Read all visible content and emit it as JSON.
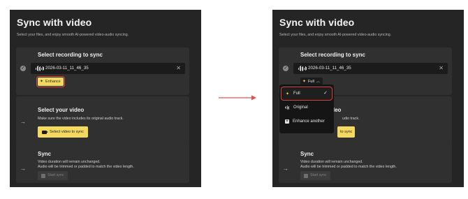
{
  "left": {
    "title": "Sync with video",
    "subtitle": "Select your files, and enjoy smooth AI-powered video-audio syncing.",
    "recording": {
      "title": "Select recording to sync",
      "file_name": "2026-03-11_11_46_35",
      "clear_glyph": "✕",
      "enhance_label": "Enhance"
    },
    "video": {
      "title": "Select your video",
      "desc": "Make sure the video includes its original audio track.",
      "button_label": "Select video to sync"
    },
    "sync": {
      "title": "Sync",
      "desc1": "Video duration will remain unchanged.",
      "desc2": "Audio will be trimmed or padded to match the video length.",
      "button_label": "Start sync"
    }
  },
  "right": {
    "title": "Sync with video",
    "subtitle": "Select your files, and enjoy smooth AI-powered video-audio syncing.",
    "recording": {
      "title": "Select recording to sync",
      "file_name": "2026-03-11_11_46_35",
      "clear_glyph": "✕",
      "mode_label": "Full"
    },
    "video": {
      "title": "Select your video",
      "title_visible": "ideo",
      "desc": "Make sure the video includes its original audio track.",
      "desc_visible": "udio track.",
      "button_label": "Select video to sync",
      "button_visible": "to sync"
    },
    "sync": {
      "title": "Sync",
      "desc1": "Video duration will remain unchanged.",
      "desc2": "Audio will be trimmed or padded to match the video length.",
      "button_label": "Start sync"
    },
    "dropdown": {
      "items": [
        {
          "label": "Full",
          "selected": true
        },
        {
          "label": "Original",
          "selected": false
        },
        {
          "label": "Enhance another",
          "selected": false
        }
      ],
      "check_glyph": "✓"
    }
  },
  "colors": {
    "panel_bg": "#252525",
    "card_bg": "#303030",
    "accent_yellow": "#f4d961",
    "highlight_red": "#e04848"
  }
}
